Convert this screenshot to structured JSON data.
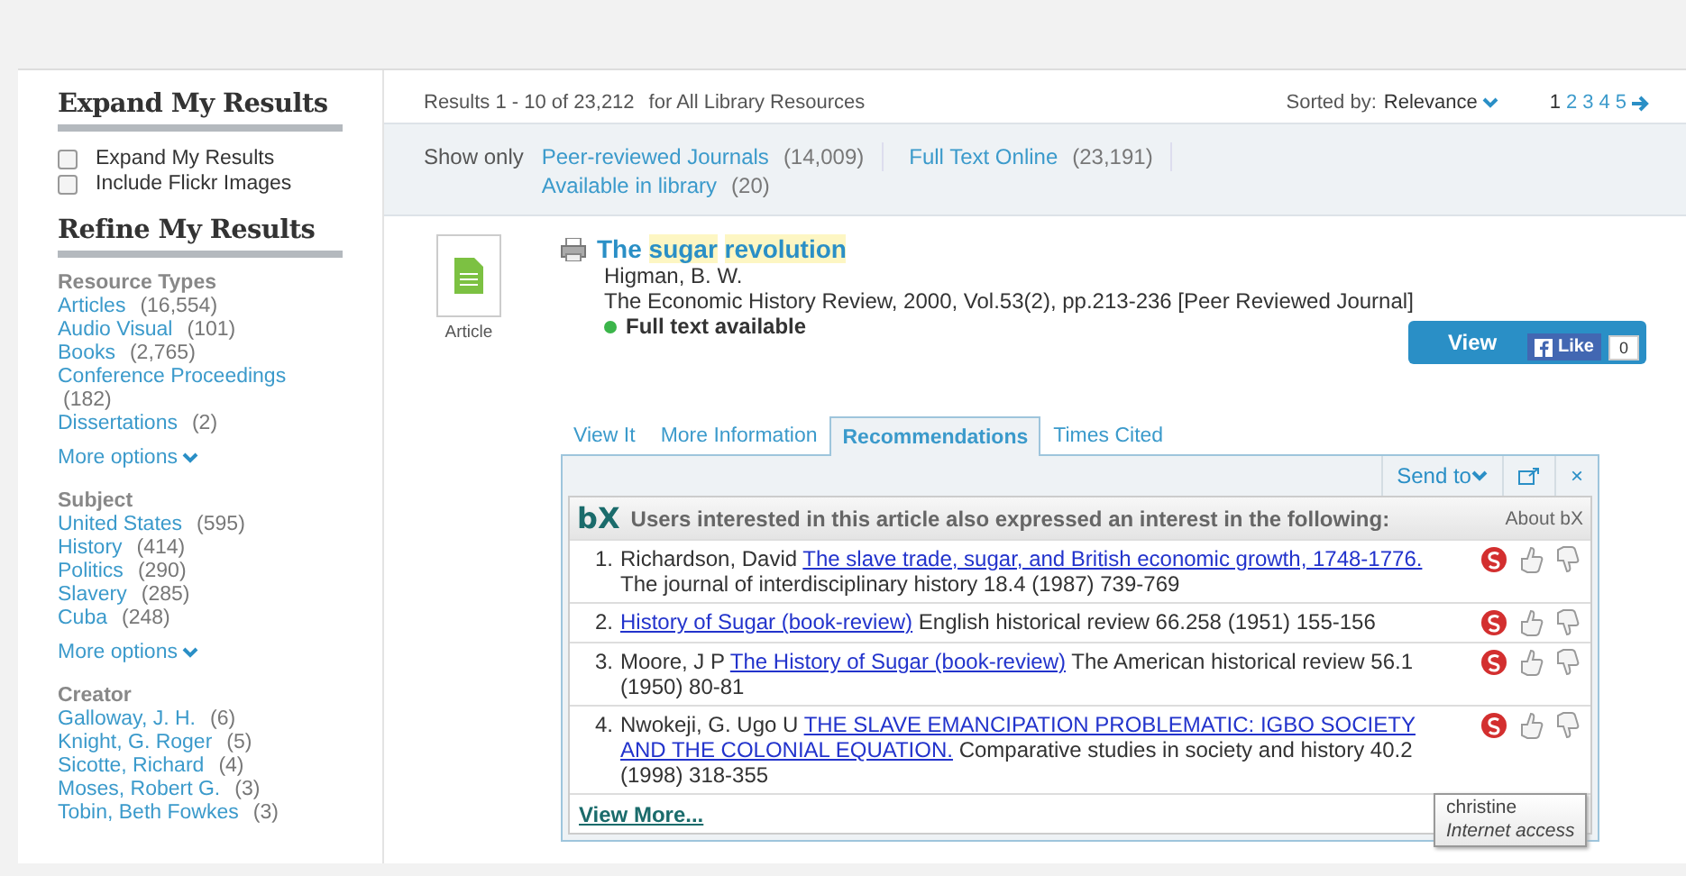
{
  "sidebar": {
    "expand_heading": "Expand My Results",
    "expand_options": [
      {
        "label": "Expand My Results",
        "checked": false
      },
      {
        "label": "Include Flickr Images",
        "checked": false
      }
    ],
    "refine_heading": "Refine My Results",
    "facets": [
      {
        "title": "Resource Types",
        "items": [
          {
            "label": "Articles",
            "count": "(16,554)"
          },
          {
            "label": "Audio Visual",
            "count": "(101)"
          },
          {
            "label": "Books",
            "count": "(2,765)"
          },
          {
            "label": "Conference Proceedings",
            "count": "(182)"
          },
          {
            "label": "Dissertations",
            "count": "(2)"
          }
        ],
        "more": "More options"
      },
      {
        "title": "Subject",
        "items": [
          {
            "label": "United States",
            "count": "(595)"
          },
          {
            "label": "History",
            "count": "(414)"
          },
          {
            "label": "Politics",
            "count": "(290)"
          },
          {
            "label": "Slavery",
            "count": "(285)"
          },
          {
            "label": "Cuba",
            "count": "(248)"
          }
        ],
        "more": "More options"
      },
      {
        "title": "Creator",
        "items": [
          {
            "label": "Galloway, J. H.",
            "count": "(6)"
          },
          {
            "label": "Knight, G. Roger",
            "count": "(5)"
          },
          {
            "label": "Sicotte, Richard",
            "count": "(4)"
          },
          {
            "label": "Moses, Robert G.",
            "count": "(3)"
          },
          {
            "label": "Tobin, Beth Fowkes",
            "count": "(3)"
          }
        ]
      }
    ]
  },
  "results_bar": {
    "summary": "Results 1 - 10 of 23,212",
    "scope": "for All Library Resources",
    "sort_label": "Sorted by:",
    "sort_value": "Relevance",
    "pages": [
      {
        "label": "1",
        "selected": true
      },
      {
        "label": "2",
        "selected": false
      },
      {
        "label": "3",
        "selected": false
      },
      {
        "label": "4",
        "selected": false
      },
      {
        "label": "5",
        "selected": false
      }
    ]
  },
  "show_only": {
    "label": "Show only",
    "filters": [
      {
        "label": "Peer-reviewed Journals",
        "count": "(14,009)"
      },
      {
        "label": "Full Text Online",
        "count": "(23,191)"
      },
      {
        "label": "Available in library",
        "count": "(20)"
      }
    ]
  },
  "record": {
    "type_label": "Article",
    "title": [
      {
        "text": "The",
        "highlight": false
      },
      {
        "text": "sugar",
        "highlight": true
      },
      {
        "text": "revolution",
        "highlight": true
      }
    ],
    "author": "Higman, B. W.",
    "source": "The Economic History Review, 2000, Vol.53(2), pp.213-236 [Peer Reviewed Journal]",
    "availability": "Full text available",
    "view_button": "View",
    "like": {
      "label": "Like",
      "count": "0"
    },
    "tabs": [
      {
        "label": "View It",
        "selected": false
      },
      {
        "label": "More Information",
        "selected": false
      },
      {
        "label": "Recommendations",
        "selected": true
      },
      {
        "label": "Times Cited",
        "selected": false
      }
    ],
    "send_to": "Send to",
    "close": "×",
    "recommendations": {
      "logo": "bX",
      "heading": "Users interested in this article also expressed an interest in the following:",
      "about": "About bX",
      "items": [
        {
          "number": "1.",
          "author": "Richardson, David",
          "link": "The slave trade, sugar, and British economic growth, 1748-1776.",
          "rest": "The journal of interdisciplinary history 18.4 (1987) 739-769"
        },
        {
          "number": "2.",
          "link": "History of Sugar (book-review)",
          "rest": "English historical review 66.258 (1951) 155-156"
        },
        {
          "number": "3.",
          "author": "Moore, J P",
          "link": "The History of Sugar (book-review)",
          "rest": "The American historical review 56.1 (1950) 80-81"
        },
        {
          "number": "4.",
          "author": "Nwokeji, G. Ugo U",
          "link_lines": [
            "THE SLAVE EMANCIPATION PROBLEMATIC: IGBO SOCIETY",
            "AND THE COLONIAL EQUATION."
          ],
          "rest": "Comparative studies in society and history 40.2 (1998) 318-355"
        }
      ],
      "view_more": "View More..."
    },
    "tooltip": {
      "name": "christine",
      "detail": "Internet access"
    }
  }
}
